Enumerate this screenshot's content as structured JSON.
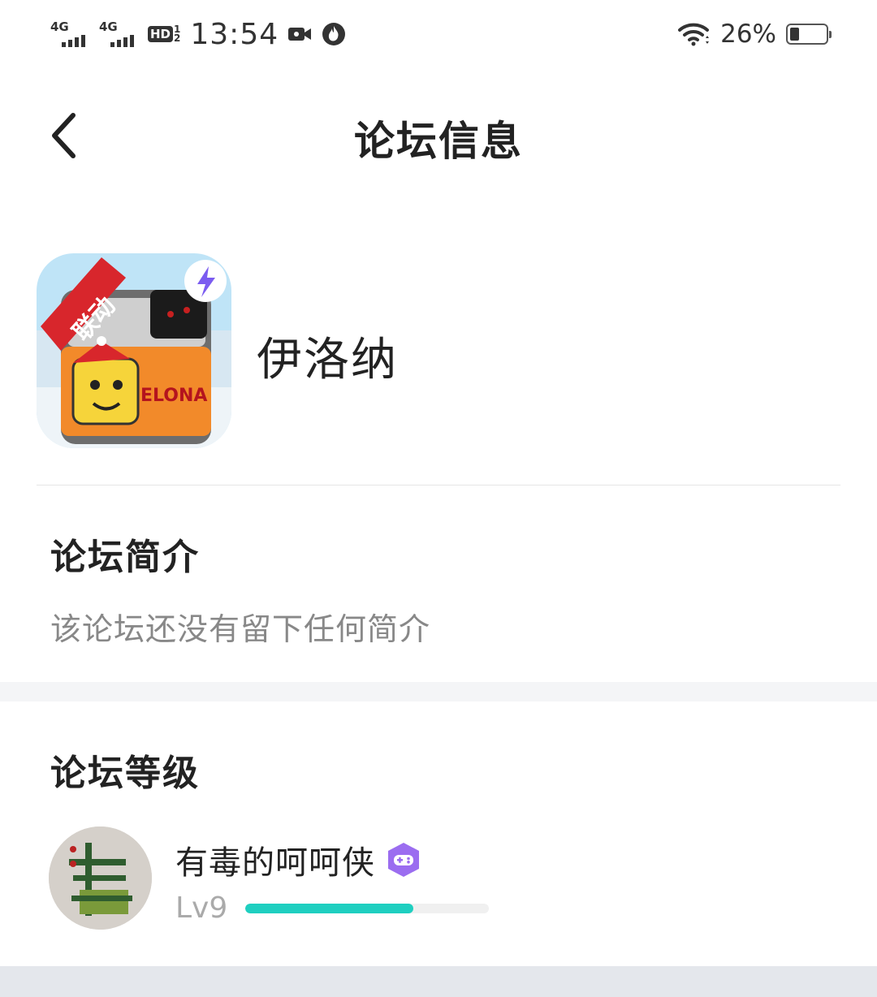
{
  "status_bar": {
    "signal1_label": "4G",
    "signal2_label": "4G",
    "hd_label": "HD",
    "hd_fraction_top": "1",
    "hd_fraction_bottom": "2",
    "time": "13:54",
    "battery_percent_text": "26%",
    "battery_level": 0.26,
    "icons": [
      "signal-icon",
      "signal-icon",
      "hd-voice-icon",
      "video-icon",
      "app-notification-icon",
      "wifi-icon",
      "battery-icon"
    ]
  },
  "nav": {
    "title": "论坛信息",
    "back_icon": "chevron-left-icon"
  },
  "forum": {
    "name": "伊洛纳",
    "icon_ribbon_text": "联动",
    "icon_logo_text": "ELONA"
  },
  "intro": {
    "title": "论坛简介",
    "text": "该论坛还没有留下任何简介"
  },
  "level": {
    "title": "论坛等级",
    "user": {
      "name": "有毒的呵呵侠",
      "badge_icon": "gamepad-badge-icon",
      "level_label": "Lv9",
      "progress": 0.69
    }
  },
  "colors": {
    "accent": "#1ecfc0",
    "badge": "#9b6df0",
    "muted_text": "#888888",
    "section_gap": "#f4f5f7"
  }
}
